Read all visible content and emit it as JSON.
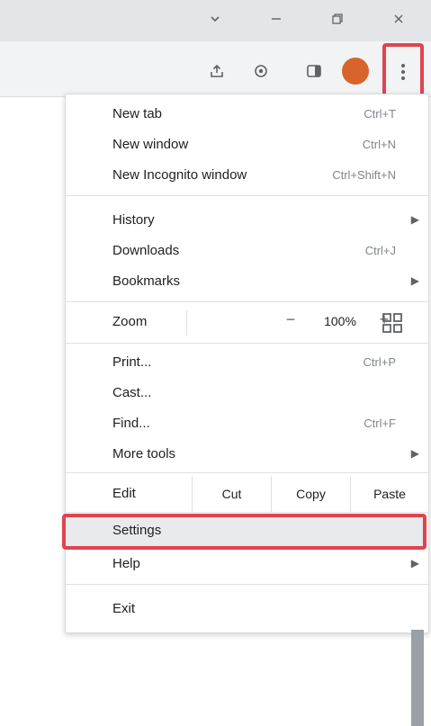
{
  "titlebar": {
    "buttons": [
      "chevron-down-icon",
      "minimize-icon",
      "restore-icon",
      "close-icon"
    ]
  },
  "toolbar": {
    "icons": [
      "share-icon",
      "extensions-icon",
      "side-panel-icon"
    ],
    "avatar_initial": "",
    "menu_icon": "three-dot-menu-icon"
  },
  "menu": {
    "new_tab": {
      "label": "New tab",
      "shortcut": "Ctrl+T"
    },
    "new_window": {
      "label": "New window",
      "shortcut": "Ctrl+N"
    },
    "new_incognito": {
      "label": "New Incognito window",
      "shortcut": "Ctrl+Shift+N"
    },
    "history": {
      "label": "History"
    },
    "downloads": {
      "label": "Downloads",
      "shortcut": "Ctrl+J"
    },
    "bookmarks": {
      "label": "Bookmarks"
    },
    "zoom": {
      "label": "Zoom",
      "minus": "−",
      "value": "100%",
      "plus": "+"
    },
    "print": {
      "label": "Print...",
      "shortcut": "Ctrl+P"
    },
    "cast": {
      "label": "Cast..."
    },
    "find": {
      "label": "Find...",
      "shortcut": "Ctrl+F"
    },
    "more_tools": {
      "label": "More tools"
    },
    "edit": {
      "label": "Edit",
      "cut": "Cut",
      "copy": "Copy",
      "paste": "Paste"
    },
    "settings": {
      "label": "Settings"
    },
    "help": {
      "label": "Help"
    },
    "exit": {
      "label": "Exit"
    }
  },
  "colors": {
    "highlight": "#e0434f",
    "avatar": "#d8642b"
  }
}
